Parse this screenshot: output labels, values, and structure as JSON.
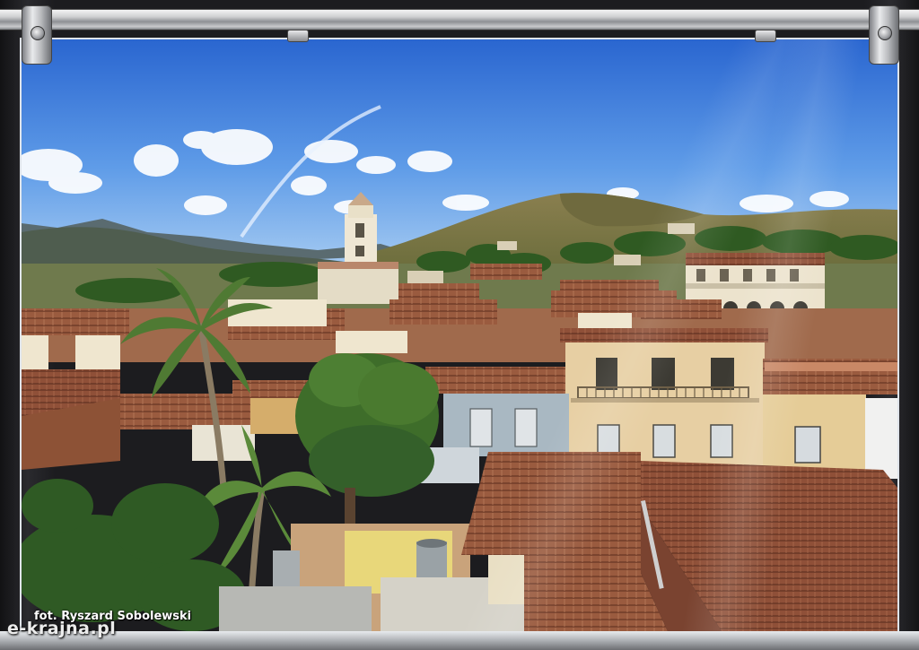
{
  "photo_credit": "fot. Ryszard Sobolewski",
  "watermark": "e-krajna.pl",
  "colors": {
    "sky_top": "#2f6fd3",
    "sky_bottom": "#8fc0f0",
    "roof_tile": "#9a5a3c",
    "wall_cream": "#e6d6a8",
    "foliage": "#3d6b2a",
    "metal": "#c9cacc"
  }
}
